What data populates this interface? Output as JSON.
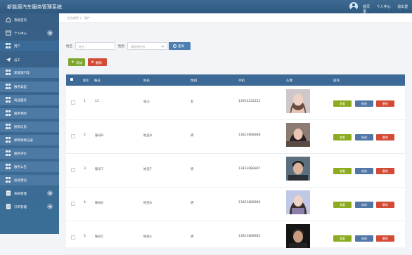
{
  "app": {
    "title": "新能源汽车服务管理系统"
  },
  "header": {
    "links": [
      "首页",
      "个人中心",
      "退出登录"
    ]
  },
  "sidebar": {
    "items": [
      {
        "label": "系统首页",
        "icon": "home-icon"
      },
      {
        "label": "个人中心",
        "icon": "user-card-icon",
        "expandable": true
      },
      {
        "label": "用户",
        "icon": "grid-icon",
        "sub": true,
        "active": true
      },
      {
        "label": "员工",
        "icon": "send-icon"
      },
      {
        "label": "新能源汽车",
        "icon": "grid-icon",
        "sub": true
      },
      {
        "label": "服务类型",
        "icon": "grid-icon",
        "sub": true
      },
      {
        "label": "商品服务",
        "icon": "grid-icon",
        "sub": true
      },
      {
        "label": "服务预约",
        "icon": "grid-icon",
        "sub": true
      },
      {
        "label": "接单信息",
        "icon": "grid-icon",
        "sub": true
      },
      {
        "label": "保养保修记录",
        "icon": "grid-icon",
        "sub": true
      },
      {
        "label": "服务评价",
        "icon": "grid-icon",
        "sub": true
      },
      {
        "label": "服务公告",
        "icon": "grid-icon",
        "sub": true
      },
      {
        "label": "投诉建议",
        "icon": "grid-icon",
        "sub": true
      },
      {
        "label": "系统管理",
        "icon": "doc-icon",
        "expandable": true
      },
      {
        "label": "订单管理",
        "icon": "doc-icon",
        "expandable": true
      }
    ]
  },
  "breadcrumb": {
    "home": "后台首页",
    "current": "用户"
  },
  "search": {
    "name_label": "姓名",
    "name_placeholder": "姓名",
    "gender_label": "性别",
    "gender_placeholder": "请选择性别",
    "query_label": "查询"
  },
  "toolbar": {
    "add_label": "添加",
    "delete_label": "删除"
  },
  "table": {
    "headers": [
      "索引",
      "账号",
      "姓名",
      "性别",
      "手机",
      "头像",
      "操作"
    ],
    "rows": [
      {
        "index": "1",
        "account": "11",
        "name": "张三",
        "gender": "女",
        "phone": "13922222222"
      },
      {
        "index": "2",
        "account": "账号8",
        "name": "姓名8",
        "gender": "男",
        "phone": "13823888888"
      },
      {
        "index": "3",
        "account": "账号7",
        "name": "姓名7",
        "gender": "男",
        "phone": "13823888887"
      },
      {
        "index": "4",
        "account": "账号6",
        "name": "姓名6",
        "gender": "男",
        "phone": "13823888886"
      },
      {
        "index": "5",
        "account": "账号5",
        "name": "姓名5",
        "gender": "男",
        "phone": "13823888885"
      }
    ],
    "actions": {
      "view": "查看",
      "edit": "修改",
      "delete": "删除"
    }
  },
  "colors": {
    "sidebar": "#385f86",
    "header": "#3c6996",
    "view": "#8cab1f",
    "edit": "#4f76a5",
    "delete": "#d24b36"
  }
}
